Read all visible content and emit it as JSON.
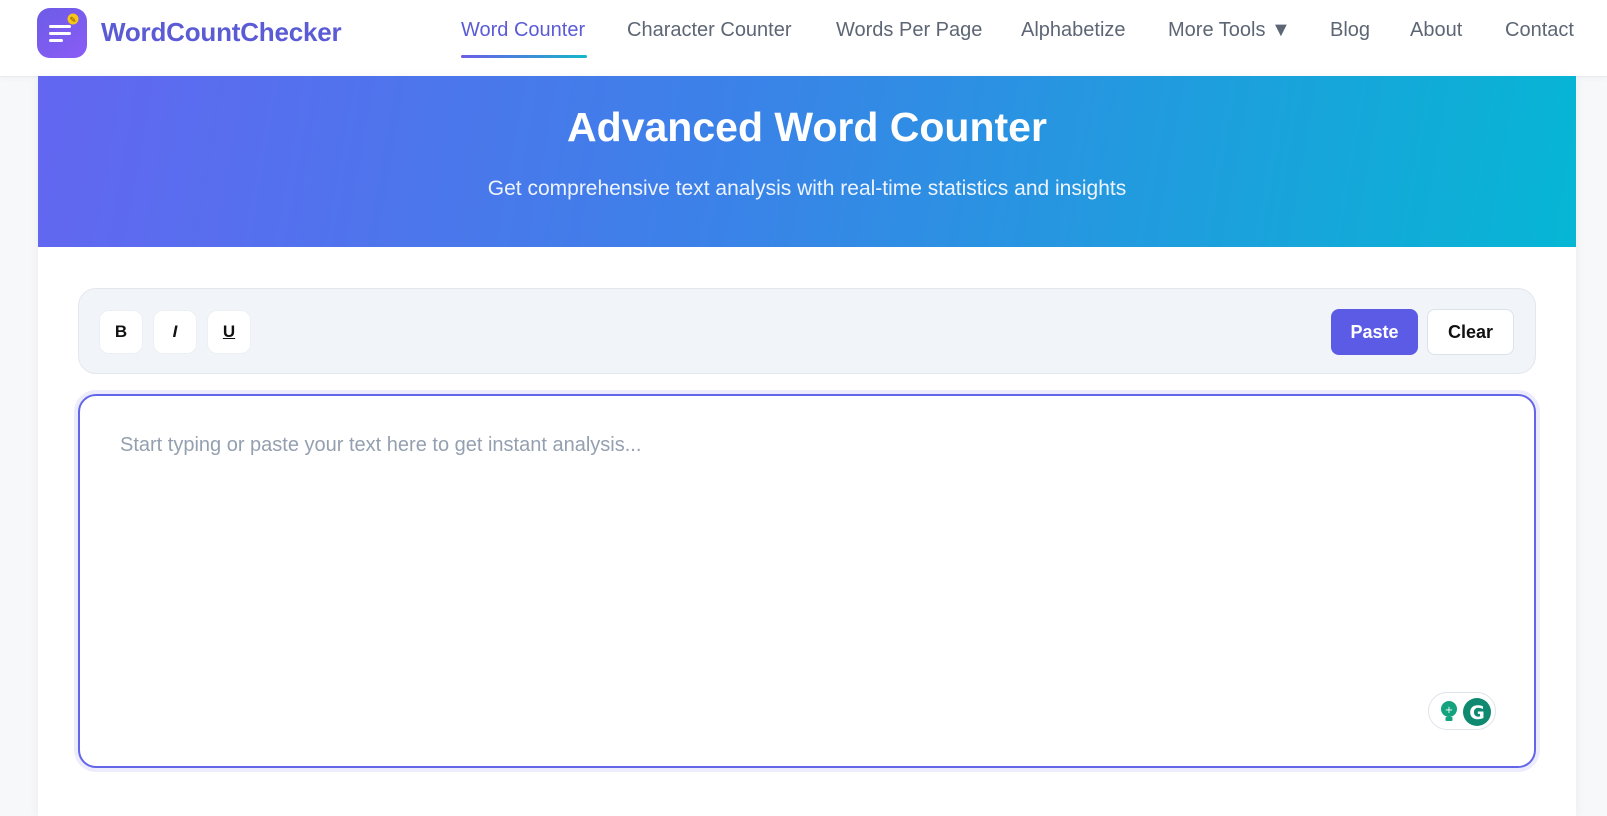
{
  "header": {
    "brand": "WordCountChecker",
    "nav": [
      {
        "label": "Word Counter",
        "active": true
      },
      {
        "label": "Character Counter"
      },
      {
        "label": "Words Per Page"
      },
      {
        "label": "Alphabetize"
      },
      {
        "label": "More Tools ▼"
      },
      {
        "label": "Blog"
      },
      {
        "label": "About"
      },
      {
        "label": "Contact"
      }
    ]
  },
  "hero": {
    "title": "Advanced Word Counter",
    "subtitle": "Get comprehensive text analysis with real-time statistics and insights"
  },
  "toolbar": {
    "bold": "B",
    "italic": "I",
    "underline": "U",
    "paste": "Paste",
    "clear": "Clear"
  },
  "editor": {
    "placeholder": "Start typing or paste your text here to get instant analysis...",
    "value": ""
  },
  "colors": {
    "accent": "#5b5be6",
    "hero_start": "#6366f1",
    "hero_end": "#06b6d4",
    "grammarly": "#15a37f"
  },
  "icons": {
    "logo": "document-lines-icon",
    "grammarly_suggest": "lightbulb-icon",
    "grammarly": "grammarly-g-icon"
  }
}
